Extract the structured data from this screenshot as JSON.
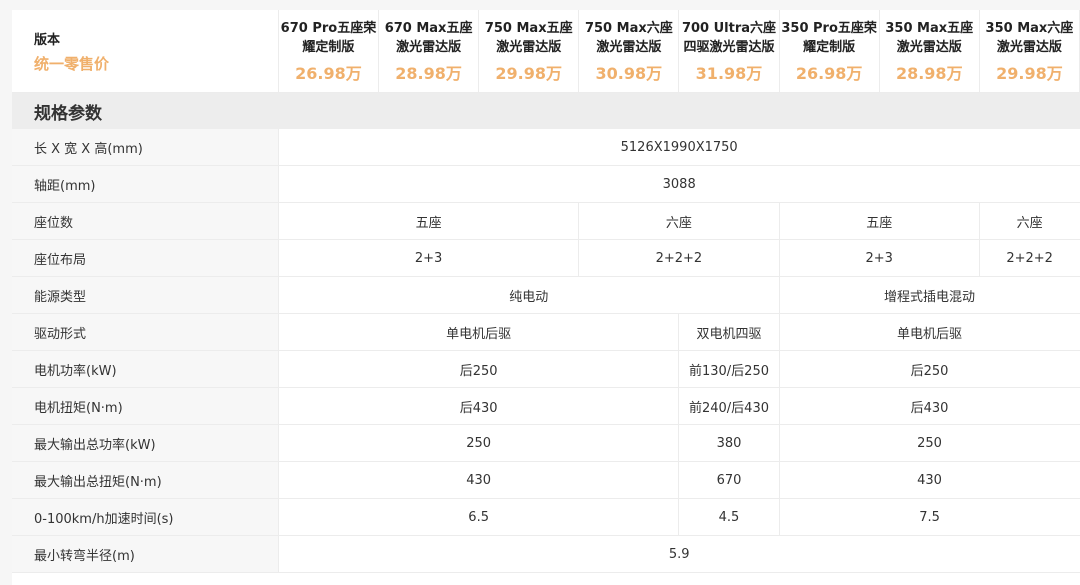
{
  "header": {
    "label_title": "版本",
    "label_sub": "统一零售价",
    "variants": [
      {
        "name": "670 Pro五座荣耀定制版",
        "price": "26.98万"
      },
      {
        "name": "670 Max五座激光雷达版",
        "price": "28.98万"
      },
      {
        "name": "750 Max五座激光雷达版",
        "price": "29.98万"
      },
      {
        "name": "750 Max六座激光雷达版",
        "price": "30.98万"
      },
      {
        "name": "700 Ultra六座四驱激光雷达版",
        "price": "31.98万"
      },
      {
        "name": "350 Pro五座荣耀定制版",
        "price": "26.98万"
      },
      {
        "name": "350 Max五座激光雷达版",
        "price": "28.98万"
      },
      {
        "name": "350 Max六座激光雷达版",
        "price": "29.98万"
      }
    ]
  },
  "section_title": "规格参数",
  "specs": [
    {
      "label": "长 X 宽 X 高(mm)",
      "values": [
        {
          "text": "5126X1990X1750",
          "span": 8
        }
      ]
    },
    {
      "label": "轴距(mm)",
      "values": [
        {
          "text": "3088",
          "span": 8
        }
      ]
    },
    {
      "label": "座位数",
      "values": [
        {
          "text": "五座",
          "span": 3
        },
        {
          "text": "六座",
          "span": 2
        },
        {
          "text": "五座",
          "span": 2
        },
        {
          "text": "六座",
          "span": 1
        }
      ]
    },
    {
      "label": "座位布局",
      "values": [
        {
          "text": "2+3",
          "span": 3
        },
        {
          "text": "2+2+2",
          "span": 2
        },
        {
          "text": "2+3",
          "span": 2
        },
        {
          "text": "2+2+2",
          "span": 1
        }
      ]
    },
    {
      "label": "能源类型",
      "values": [
        {
          "text": "纯电动",
          "span": 5
        },
        {
          "text": "增程式插电混动",
          "span": 3
        }
      ]
    },
    {
      "label": "驱动形式",
      "values": [
        {
          "text": "单电机后驱",
          "span": 4
        },
        {
          "text": "双电机四驱",
          "span": 1
        },
        {
          "text": "单电机后驱",
          "span": 3
        }
      ]
    },
    {
      "label": "电机功率(kW)",
      "values": [
        {
          "text": "后250",
          "span": 4
        },
        {
          "text": "前130/后250",
          "span": 1
        },
        {
          "text": "后250",
          "span": 3
        }
      ]
    },
    {
      "label": "电机扭矩(N·m)",
      "values": [
        {
          "text": "后430",
          "span": 4
        },
        {
          "text": "前240/后430",
          "span": 1
        },
        {
          "text": "后430",
          "span": 3
        }
      ]
    },
    {
      "label": "最大输出总功率(kW)",
      "values": [
        {
          "text": "250",
          "span": 4
        },
        {
          "text": "380",
          "span": 1
        },
        {
          "text": "250",
          "span": 3
        }
      ]
    },
    {
      "label": "最大输出总扭矩(N·m)",
      "values": [
        {
          "text": "430",
          "span": 4
        },
        {
          "text": "670",
          "span": 1
        },
        {
          "text": "430",
          "span": 3
        }
      ]
    },
    {
      "label": "0-100km/h加速时间(s)",
      "values": [
        {
          "text": "6.5",
          "span": 4
        },
        {
          "text": "4.5",
          "span": 1
        },
        {
          "text": "7.5",
          "span": 3
        }
      ]
    },
    {
      "label": "最小转弯半径(m)",
      "values": [
        {
          "text": "5.9",
          "span": 8
        }
      ]
    }
  ]
}
